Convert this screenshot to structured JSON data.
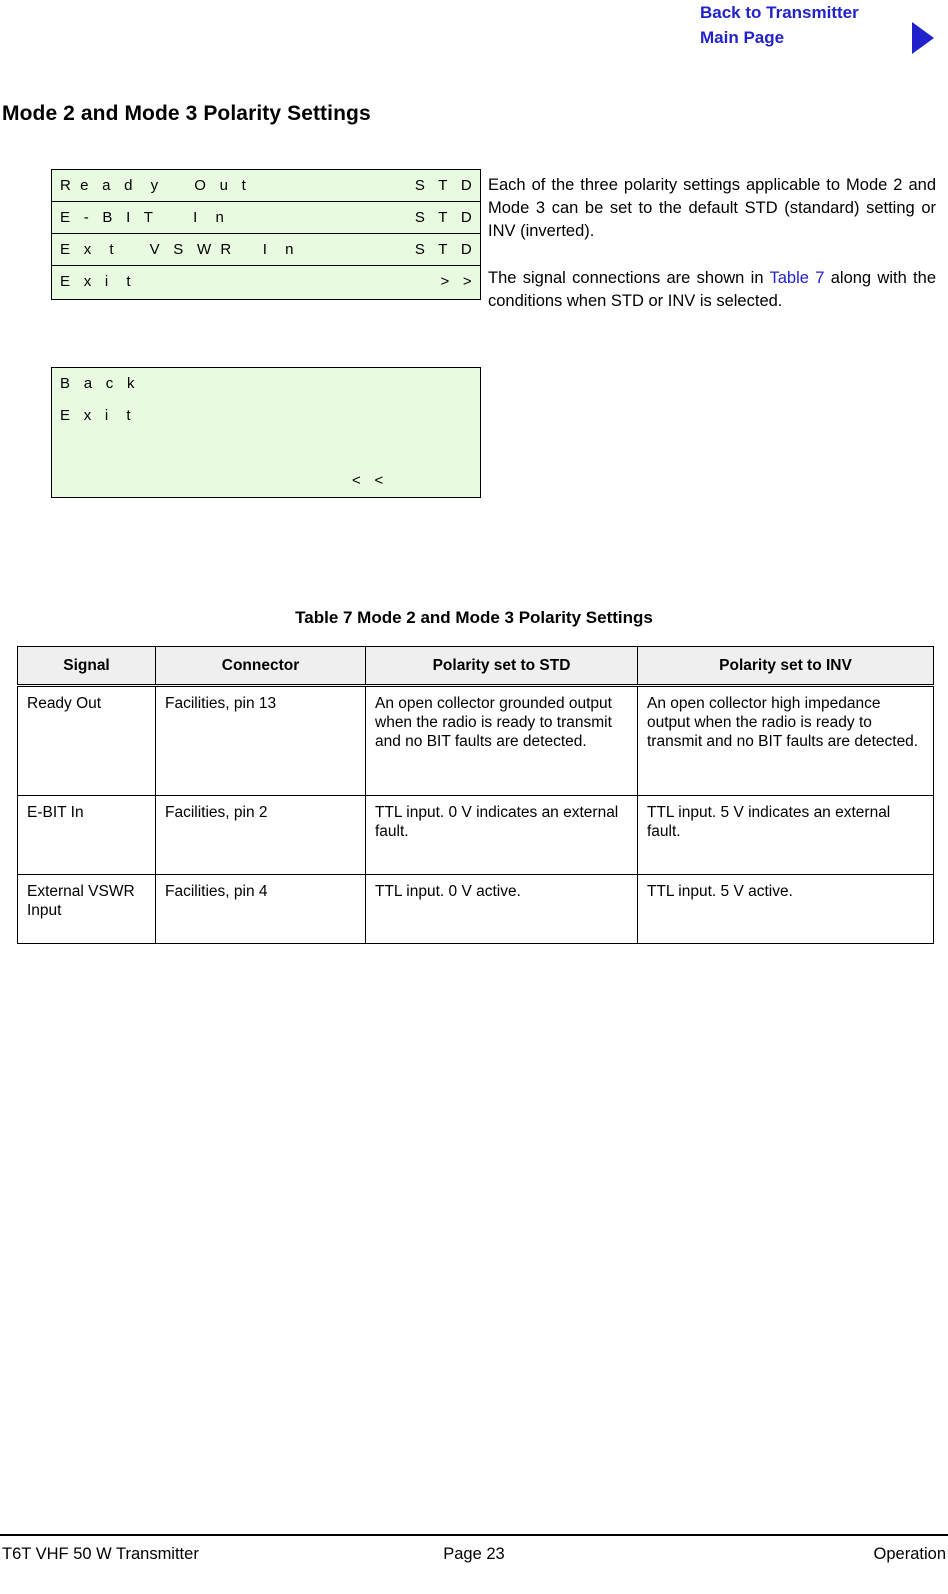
{
  "nav": {
    "line1": "Back to Transmitter",
    "line2": "Main Page",
    "arrow_icon": "right-triangle-icon",
    "link_color": "#2222cc"
  },
  "section_title": "Mode 2 and Mode 3 Polarity Settings",
  "lcd_screens": [
    {
      "name": "polarity-menu-screen",
      "rows": [
        {
          "left": "R  e   a   d    y        O   u   t",
          "right": "S   T   D"
        },
        {
          "left": "E   -   B   I   T         I    n",
          "right": "S   T   D"
        },
        {
          "left": "E   x    t        V   S   W  R       I    n",
          "right": "S   T   D"
        },
        {
          "left": "E   x   i    t",
          "right": ">   >"
        }
      ]
    },
    {
      "name": "back-exit-screen",
      "rows": [
        {
          "left": "B   a   c   k",
          "right": ""
        },
        {
          "left": "E   x   i    t",
          "right": ""
        },
        {
          "left": "",
          "right": ""
        },
        {
          "left": "",
          "right": "<   <"
        }
      ]
    }
  ],
  "paragraphs": {
    "p1": "Each of the three polarity settings applicable to Mode 2 and Mode 3 can be set to the default STD (standard) setting or INV (inverted).",
    "p2_before": "The signal connections are shown in ",
    "p2_link": "Table 7",
    "p2_after": " along with the conditions when STD or INV is selected."
  },
  "table": {
    "caption": "Table 7  Mode 2 and Mode 3 Polarity Settings",
    "headers": [
      "Signal",
      "Connector",
      "Polarity set to STD",
      "Polarity set to INV"
    ],
    "rows": [
      {
        "signal": "Ready Out",
        "connector": "Facilities, pin 13",
        "std": "An open collector grounded output when the radio is ready to transmit and no BIT faults are detected.",
        "inv": "An open collector high impedance output when the radio is ready to transmit and no BIT faults are detected."
      },
      {
        "signal": "E-BIT In",
        "connector": "Facilities, pin 2",
        "std": "TTL input. 0 V indicates an external fault.",
        "inv": "TTL input. 5 V indicates an external fault."
      },
      {
        "signal": "External VSWR Input",
        "connector": "Facilities, pin 4",
        "std": "TTL input. 0 V active.",
        "inv": "TTL input. 5 V active."
      }
    ]
  },
  "footer": {
    "left": "T6T VHF 50 W Transmitter",
    "center": "Page 23",
    "right": "Operation"
  }
}
